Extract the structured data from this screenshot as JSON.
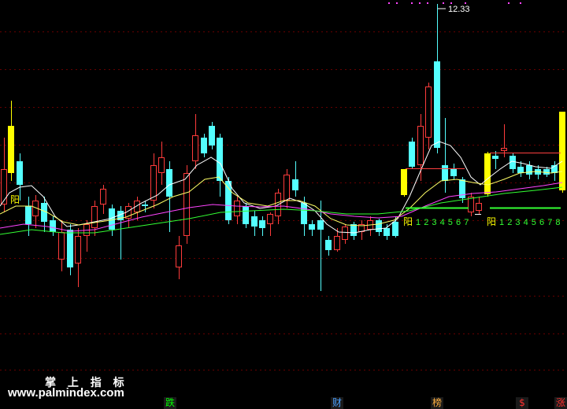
{
  "watermark": {
    "title": "掌 上 指 标",
    "url": "www.palmindex.com"
  },
  "price_label": "12.33",
  "yang_label": "阳",
  "count_sequences": [
    [
      "1",
      "2",
      "3",
      "4",
      "5",
      "6",
      "7"
    ],
    [
      "1",
      "2",
      "3",
      "4",
      "5",
      "6",
      "7",
      "8"
    ]
  ],
  "bottom_tabs": [
    {
      "label": "跌",
      "color": "#00ff00"
    },
    {
      "label": "财",
      "color": "#4aa0ff"
    },
    {
      "label": "榜",
      "color": "#ffb040"
    },
    {
      "label": "$",
      "color": "#ff3030"
    },
    {
      "label": "涨",
      "color": "#ff3030"
    }
  ],
  "colors": {
    "up": "#ff3b3b",
    "down": "#54ffff",
    "signal": "#ffff00",
    "ma_white": "#ffffff",
    "ma_yellow": "#ffff66",
    "ma_magenta": "#ff44ff",
    "ma_green": "#33ff33",
    "grid": "#660000",
    "accent_dots": "#ff44ff"
  }
}
